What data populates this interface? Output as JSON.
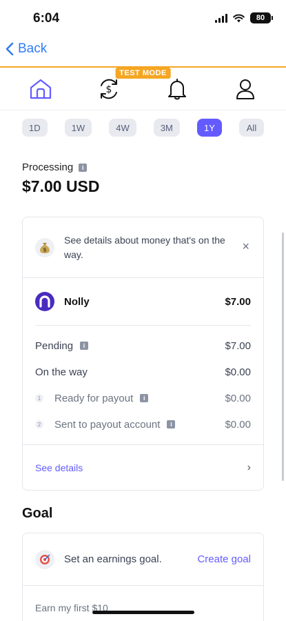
{
  "status_bar": {
    "time": "6:04",
    "battery": "80"
  },
  "nav": {
    "back_label": "Back"
  },
  "badge": {
    "test_mode": "TEST MODE"
  },
  "tabs": [
    {
      "icon": "home-icon",
      "active": true
    },
    {
      "icon": "payments-sync-icon"
    },
    {
      "icon": "bell-icon"
    },
    {
      "icon": "person-icon"
    }
  ],
  "ranges": [
    {
      "label": "1D"
    },
    {
      "label": "1W"
    },
    {
      "label": "4W"
    },
    {
      "label": "3M"
    },
    {
      "label": "1Y",
      "active": true
    },
    {
      "label": "All"
    }
  ],
  "processing": {
    "label": "Processing",
    "amount": "$7.00 USD"
  },
  "details_card": {
    "banner_text": "See details about money that's on the way.",
    "close": "×",
    "account": {
      "name": "Nolly",
      "amount": "$7.00"
    },
    "rows": {
      "pending_label": "Pending",
      "pending_value": "$7.00",
      "on_the_way_label": "On the way",
      "on_the_way_value": "$0.00",
      "ready_label": "Ready for payout",
      "ready_value": "$0.00",
      "sent_label": "Sent to payout account",
      "sent_value": "$0.00"
    },
    "see_details": "See details"
  },
  "goal": {
    "title": "Goal",
    "prompt": "Set an earnings goal.",
    "action": "Create goal",
    "hint": "Earn my first $10"
  },
  "colors": {
    "accent": "#635bff",
    "link_blue": "#2f7cf6",
    "test_mode_orange": "#f5a623"
  }
}
